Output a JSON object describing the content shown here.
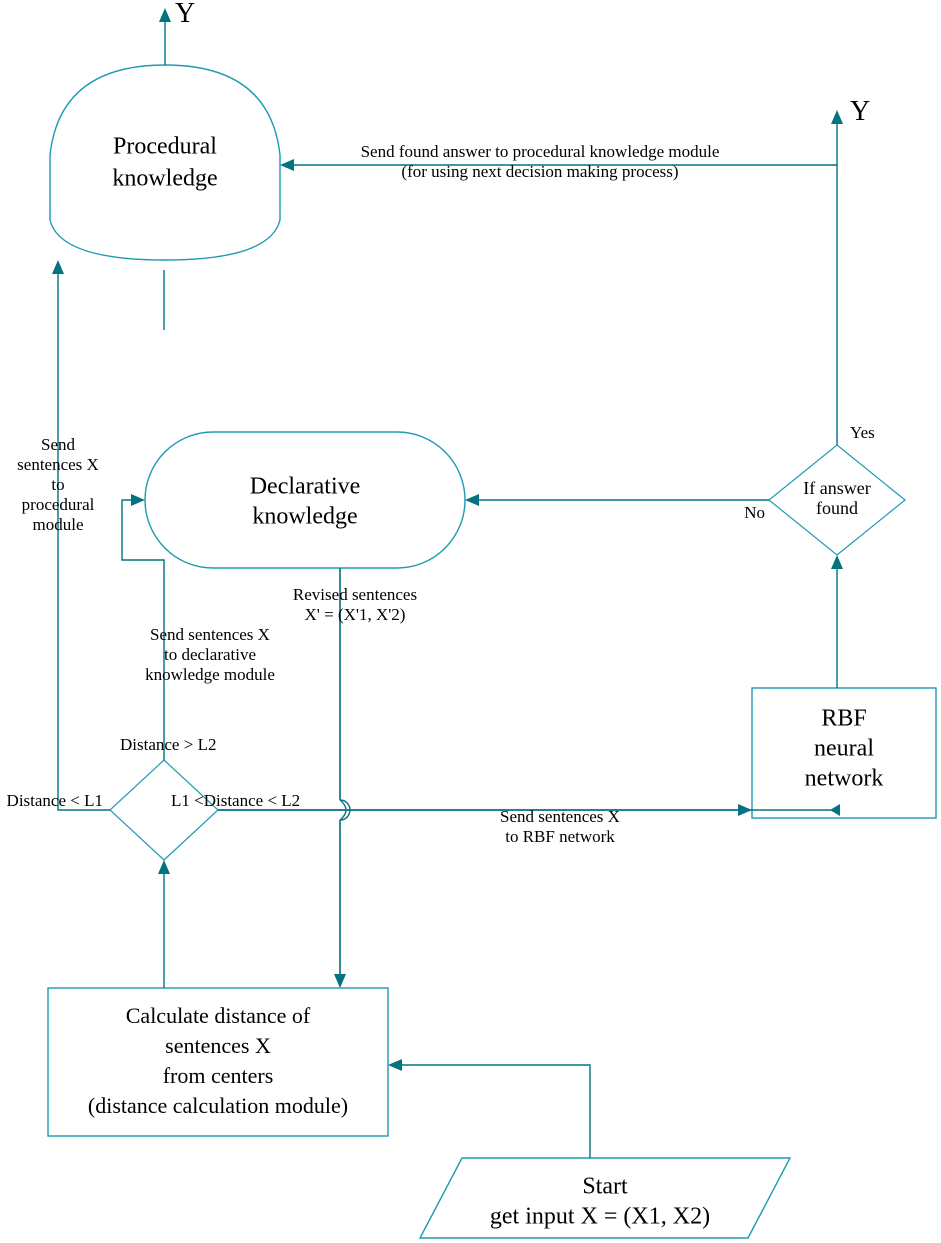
{
  "nodes": {
    "procedural": {
      "line1": "Procedural",
      "line2": "knowledge"
    },
    "declarative": {
      "line1": "Declarative",
      "line2": "knowledge"
    },
    "rbf": {
      "line1": "RBF",
      "line2": "neural",
      "line3": "network"
    },
    "start": {
      "line1": "Start",
      "line2": "get input X = (X1, X2)"
    },
    "calc": {
      "line1": "Calculate distance of",
      "line2": "sentences X",
      "line3": "from centers",
      "line4": "(distance calculation module)"
    },
    "decision_answer": {
      "line1": "If answer",
      "line2": "found"
    },
    "decision_distance": {
      "label_right": "L1 <Distance < L2"
    }
  },
  "labels": {
    "y1": "Y",
    "y2": "Y",
    "yes": "Yes",
    "no": "No",
    "send_to_procedural_multi": [
      "Send",
      "sentences X",
      "to",
      "procedural",
      "module"
    ],
    "send_to_declarative_multi": [
      "Send sentences X",
      "to declarative",
      "knowledge module"
    ],
    "distance_gt_l2": "Distance > L2",
    "distance_lt_l1": "Distance < L1",
    "revised_multi": [
      "Revised sentences",
      "X' = (X'1, X'2)"
    ],
    "send_to_rbf_multi": [
      "Send sentences X",
      "to RBF network"
    ],
    "send_found_multi": [
      "Send found answer to procedural knowledge module",
      "(for using next decision making process)"
    ]
  }
}
